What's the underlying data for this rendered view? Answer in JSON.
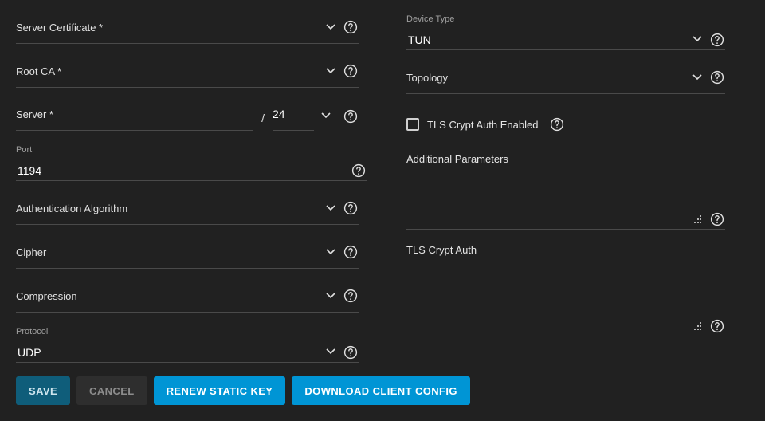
{
  "left": {
    "server_cert_label": "Server Certificate *",
    "root_ca_label": "Root CA *",
    "server_label": "Server *",
    "server_cidr_value": "24",
    "port_label": "Port",
    "port_value": "1194",
    "auth_algo_label": "Authentication Algorithm",
    "cipher_label": "Cipher",
    "compression_label": "Compression",
    "protocol_label": "Protocol",
    "protocol_value": "UDP"
  },
  "right": {
    "device_type_label": "Device Type",
    "device_type_value": "TUN",
    "topology_label": "Topology",
    "tls_crypt_checkbox_label": "TLS Crypt Auth Enabled",
    "additional_params_label": "Additional Parameters",
    "tls_crypt_auth_label": "TLS Crypt Auth"
  },
  "buttons": {
    "save": "SAVE",
    "cancel": "CANCEL",
    "renew": "RENEW STATIC KEY",
    "download": "DOWNLOAD CLIENT CONFIG"
  }
}
